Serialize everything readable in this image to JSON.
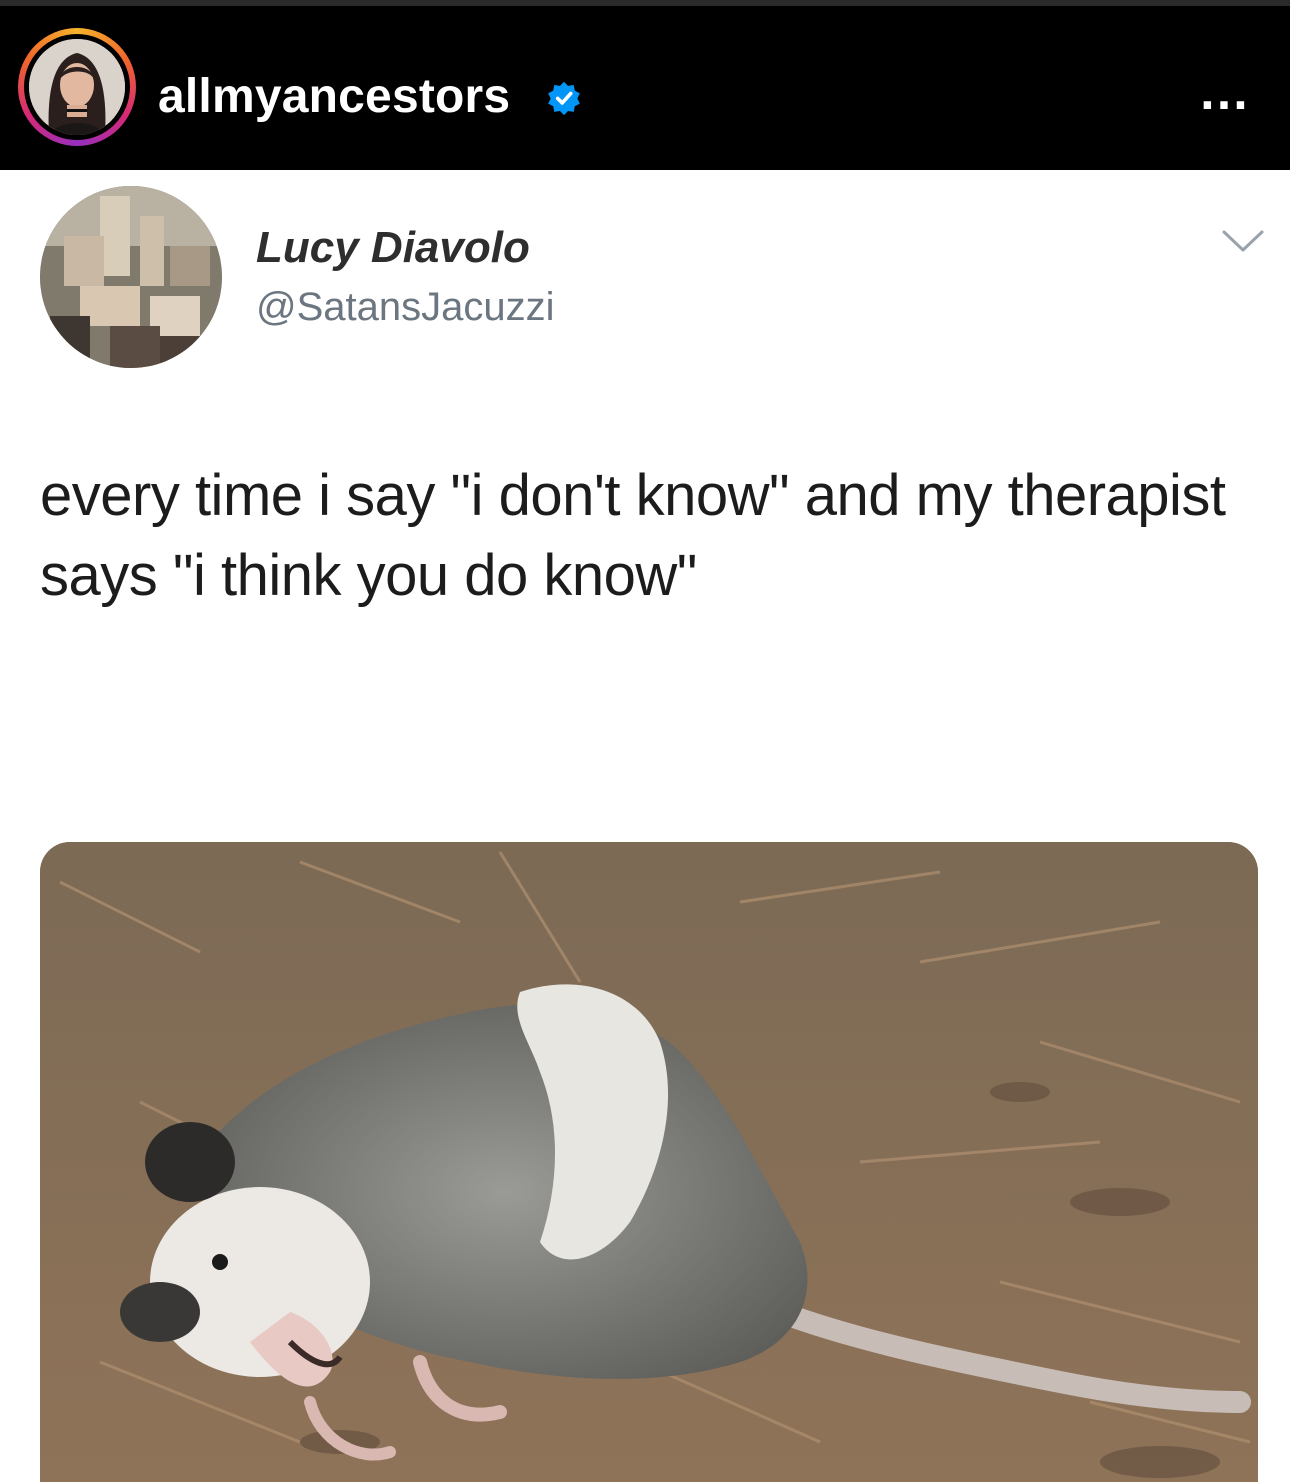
{
  "post": {
    "username": "allmyancestors",
    "verified": true,
    "more_label": "…"
  },
  "tweet": {
    "display_name": "Lucy Diavolo",
    "handle": "@SatansJacuzzi",
    "text": "every time i say \"i don't know\" and my therapist says \"i think you do know\""
  },
  "icons": {
    "avatar": "profile-photo",
    "verified": "verified-badge-icon",
    "more": "more-options-icon",
    "chevron": "chevron-down-icon",
    "photo": "opossum-photo"
  },
  "colors": {
    "header_bg": "#000000",
    "verified_blue": "#0095f6",
    "story_ring": [
      "#f7b32b",
      "#d62976",
      "#962fbf"
    ]
  }
}
